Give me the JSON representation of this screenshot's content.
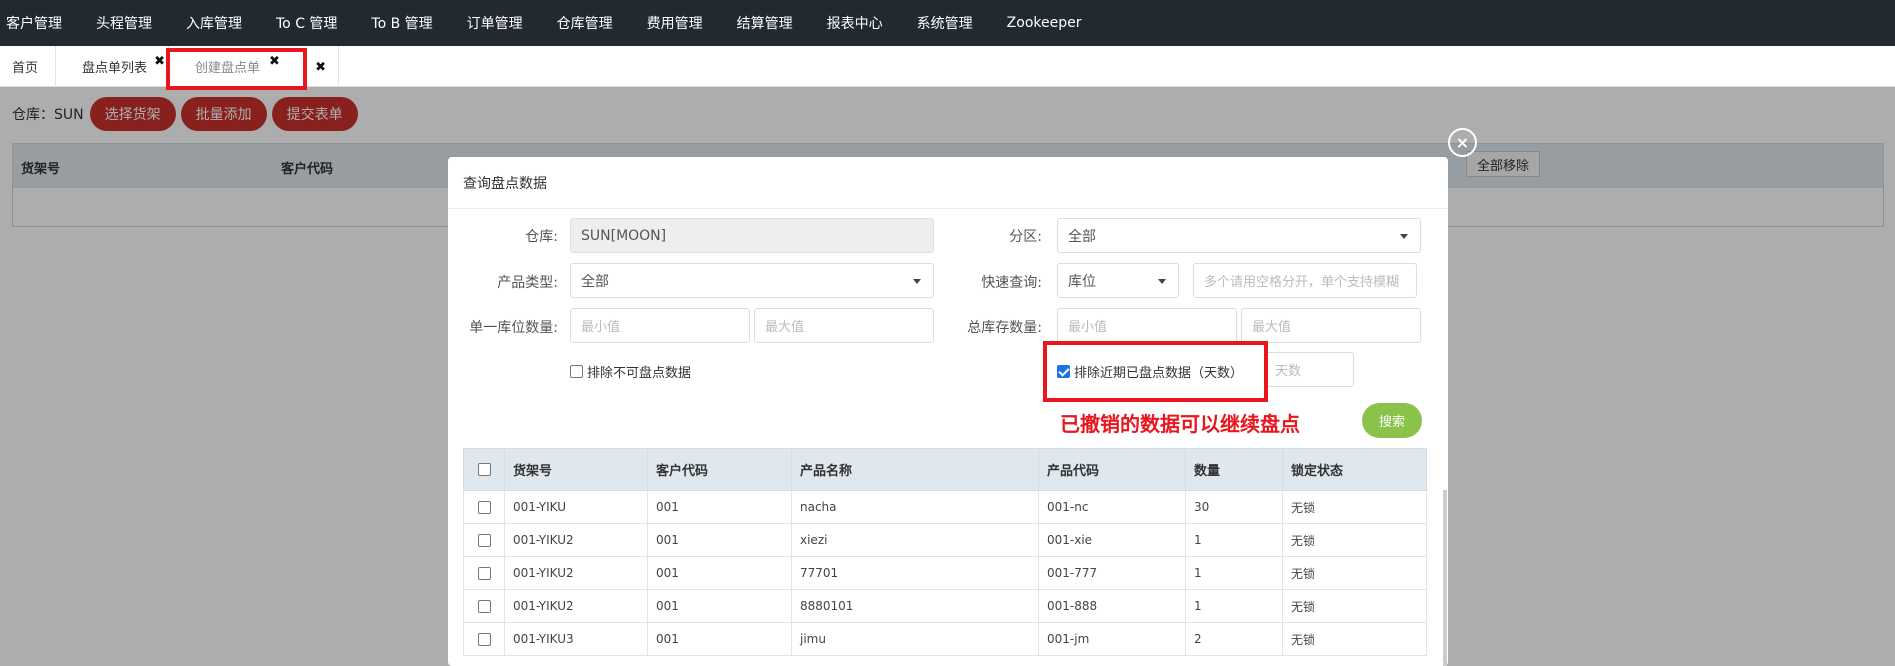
{
  "nav": {
    "items": [
      "客户管理",
      "头程管理",
      "入库管理",
      "To C 管理",
      "To B 管理",
      "订单管理",
      "仓库管理",
      "费用管理",
      "结算管理",
      "报表中心",
      "系统管理",
      "Zookeeper"
    ]
  },
  "tabs": {
    "home": "首页",
    "list": "盘点单列表",
    "create": "创建盘点单",
    "close_glyph": "✖"
  },
  "page": {
    "warehouse_label": "仓库：SUN",
    "btn_select_shelf": "选择货架",
    "btn_batch_add": "批量添加",
    "btn_submit": "提交表单",
    "table_headers": [
      "货架号",
      "客户代码"
    ],
    "btn_remove_all": "全部移除"
  },
  "modal": {
    "title": "查询盘点数据",
    "close_glyph": "×",
    "warehouse_label": "仓库:",
    "warehouse_value": "SUN[MOON]",
    "zone_label": "分区:",
    "zone_value": "全部",
    "product_type_label": "产品类型:",
    "product_type_value": "全部",
    "quick_query_label": "快速查询:",
    "quick_query_value": "库位",
    "quick_query_placeholder": "多个请用空格分开，单个支持模糊",
    "single_qty_label": "单一库位数量:",
    "total_qty_label": "总库存数量:",
    "min_placeholder": "最小值",
    "max_placeholder": "最大值",
    "exclude_uncountable": "排除不可盘点数据",
    "exclude_recent": "排除近期已盘点数据（天数）",
    "days_placeholder": "天数",
    "annotation": "已撤销的数据可以继续盘点",
    "search_button": "搜索",
    "table_headers": [
      "货架号",
      "客户代码",
      "产品名称",
      "产品代码",
      "数量",
      "锁定状态"
    ],
    "rows": [
      [
        "001-YIKU",
        "001",
        "nacha",
        "001-nc",
        "30",
        "无锁"
      ],
      [
        "001-YIKU2",
        "001",
        "xiezi",
        "001-xie",
        "1",
        "无锁"
      ],
      [
        "001-YIKU2",
        "001",
        "77701",
        "001-777",
        "1",
        "无锁"
      ],
      [
        "001-YIKU2",
        "001",
        "8880101",
        "001-888",
        "1",
        "无锁"
      ],
      [
        "001-YIKU3",
        "001",
        "jimu",
        "001-jm",
        "2",
        "无锁"
      ]
    ]
  },
  "colors": {
    "nav_bg": "#222a31",
    "accent_red": "#c9302c",
    "highlight": "#e8161d",
    "search_green": "#8bc34a"
  }
}
